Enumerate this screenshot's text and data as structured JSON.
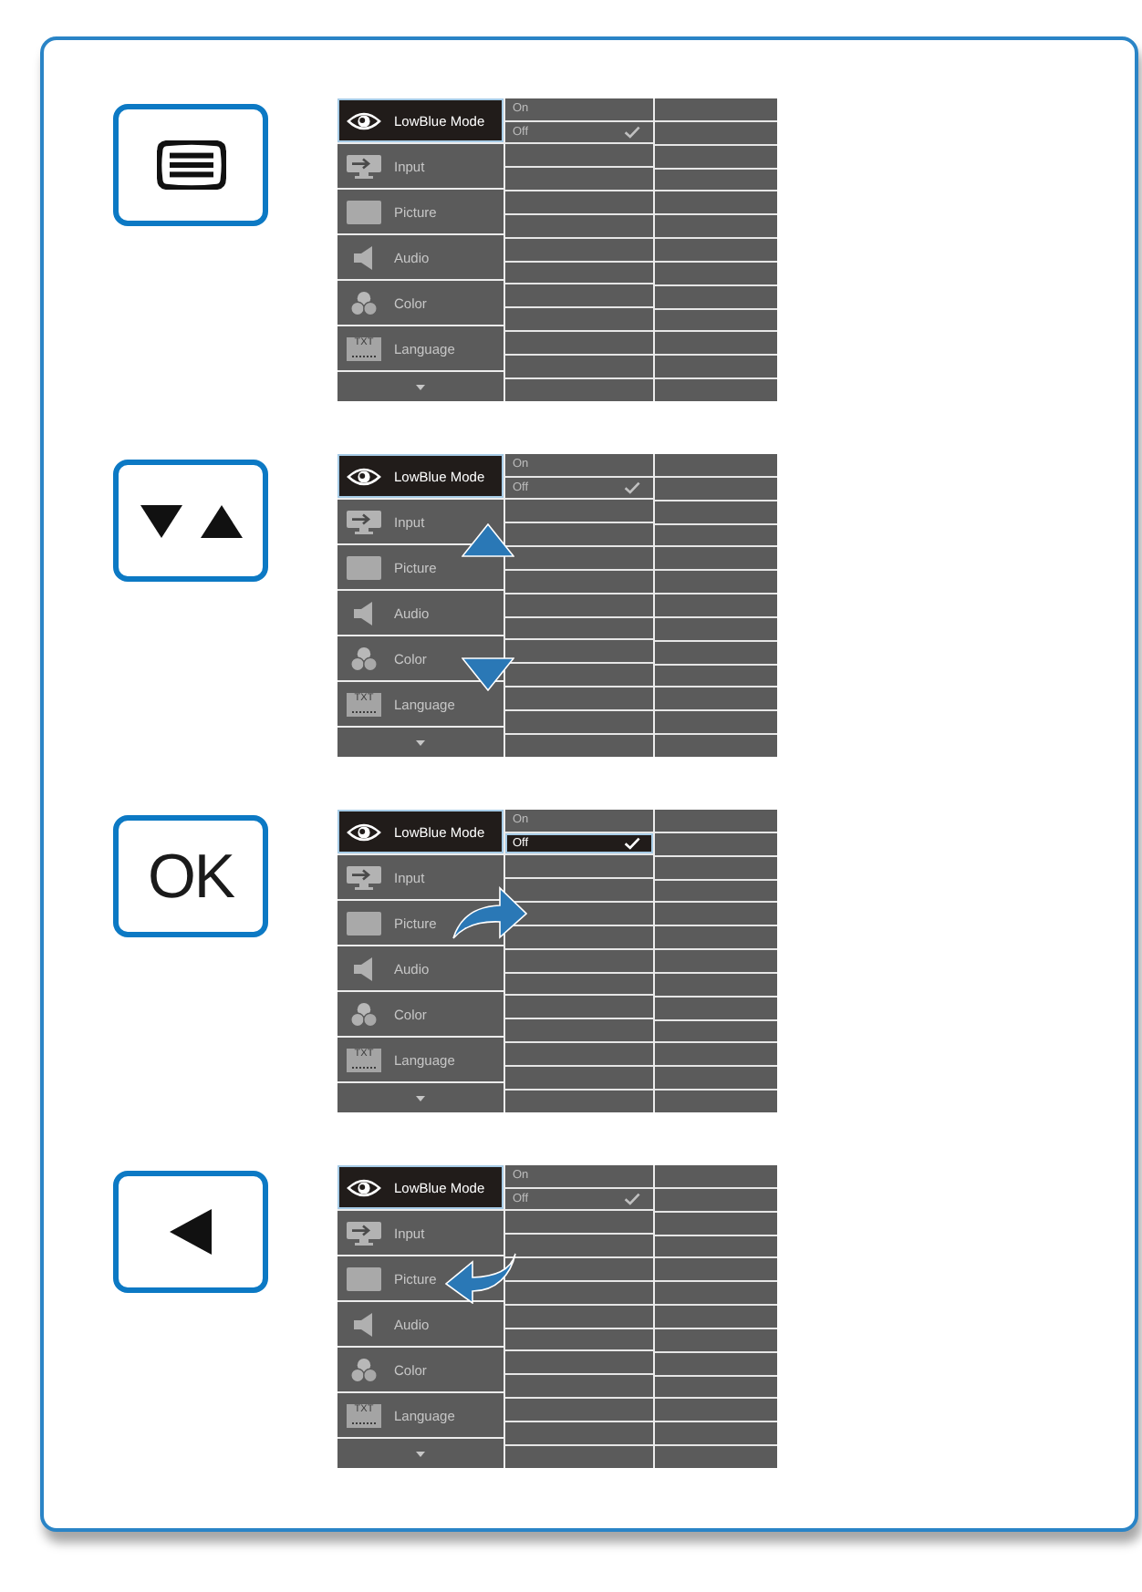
{
  "steps": [
    {
      "button": {
        "kind": "menu"
      },
      "osd": {
        "menu_items": [
          {
            "kind": "lowblue",
            "label": "LowBlue Mode",
            "selected": true
          },
          {
            "kind": "input",
            "label": "Input",
            "selected": false
          },
          {
            "kind": "picture",
            "label": "Picture",
            "selected": false
          },
          {
            "kind": "audio",
            "label": "Audio",
            "selected": false
          },
          {
            "kind": "color",
            "label": "Color",
            "selected": false
          },
          {
            "kind": "language",
            "label": "Language",
            "icon_text": "TXT",
            "selected": false
          }
        ],
        "options": [
          {
            "label": "On",
            "selected": false,
            "checked": false
          },
          {
            "label": "Off",
            "selected": false,
            "checked": true
          }
        ]
      }
    },
    {
      "button": {
        "kind": "updown"
      },
      "gesture": {
        "kind": "scroll"
      },
      "osd": {
        "menu_items": [
          {
            "kind": "lowblue",
            "label": "LowBlue Mode",
            "selected": true
          },
          {
            "kind": "input",
            "label": "Input",
            "selected": false
          },
          {
            "kind": "picture",
            "label": "Picture",
            "selected": false
          },
          {
            "kind": "audio",
            "label": "Audio",
            "selected": false
          },
          {
            "kind": "color",
            "label": "Color",
            "selected": false
          },
          {
            "kind": "language",
            "label": "Language",
            "icon_text": "TXT",
            "selected": false
          }
        ],
        "options": [
          {
            "label": "On",
            "selected": false,
            "checked": false
          },
          {
            "label": "Off",
            "selected": false,
            "checked": true
          }
        ]
      }
    },
    {
      "button": {
        "kind": "ok",
        "label": "OK"
      },
      "gesture": {
        "kind": "enter"
      },
      "osd": {
        "menu_items": [
          {
            "kind": "lowblue",
            "label": "LowBlue Mode",
            "selected": true
          },
          {
            "kind": "input",
            "label": "Input",
            "selected": false
          },
          {
            "kind": "picture",
            "label": "Picture",
            "selected": false
          },
          {
            "kind": "audio",
            "label": "Audio",
            "selected": false
          },
          {
            "kind": "color",
            "label": "Color",
            "selected": false
          },
          {
            "kind": "language",
            "label": "Language",
            "icon_text": "TXT",
            "selected": false
          }
        ],
        "options": [
          {
            "label": "On",
            "selected": false,
            "checked": false
          },
          {
            "label": "Off",
            "selected": true,
            "checked": true
          }
        ]
      }
    },
    {
      "button": {
        "kind": "back"
      },
      "gesture": {
        "kind": "back"
      },
      "osd": {
        "menu_items": [
          {
            "kind": "lowblue",
            "label": "LowBlue Mode",
            "selected": true
          },
          {
            "kind": "input",
            "label": "Input",
            "selected": false
          },
          {
            "kind": "picture",
            "label": "Picture",
            "selected": false
          },
          {
            "kind": "audio",
            "label": "Audio",
            "selected": false
          },
          {
            "kind": "color",
            "label": "Color",
            "selected": false
          },
          {
            "kind": "language",
            "label": "Language",
            "icon_text": "TXT",
            "selected": false
          }
        ],
        "options": [
          {
            "label": "On",
            "selected": false,
            "checked": false
          },
          {
            "label": "Off",
            "selected": false,
            "checked": true
          }
        ]
      }
    }
  ]
}
